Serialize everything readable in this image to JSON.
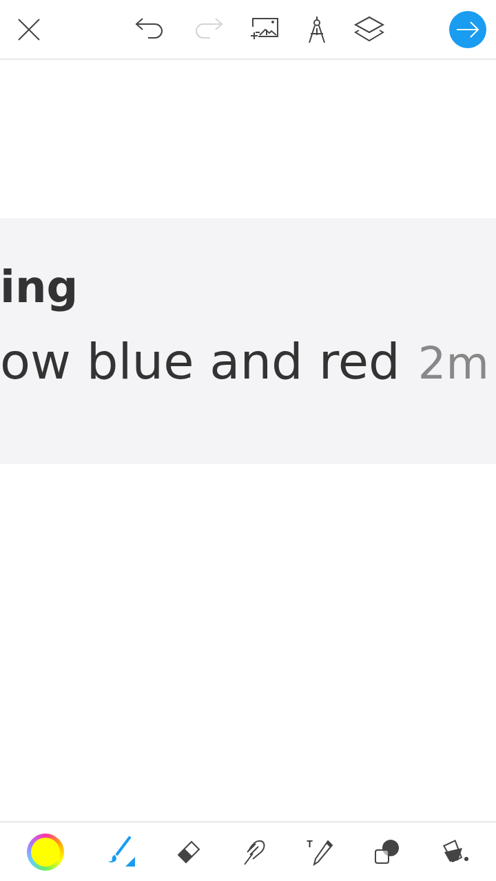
{
  "top_bar": {
    "undo": {
      "disabled": false
    },
    "redo": {
      "disabled": true
    }
  },
  "canvas": {
    "heading": "ing",
    "body": "ow blue and red",
    "time": "2m"
  },
  "tools": [
    {
      "kind": "color",
      "color": "#ffff00",
      "selected": false
    },
    {
      "kind": "brush",
      "selected": true
    },
    {
      "kind": "eraser",
      "selected": false
    },
    {
      "kind": "smudge",
      "selected": false
    },
    {
      "kind": "text",
      "label": "T",
      "selected": false
    },
    {
      "kind": "shape",
      "selected": false
    },
    {
      "kind": "fill",
      "selected": false
    }
  ]
}
